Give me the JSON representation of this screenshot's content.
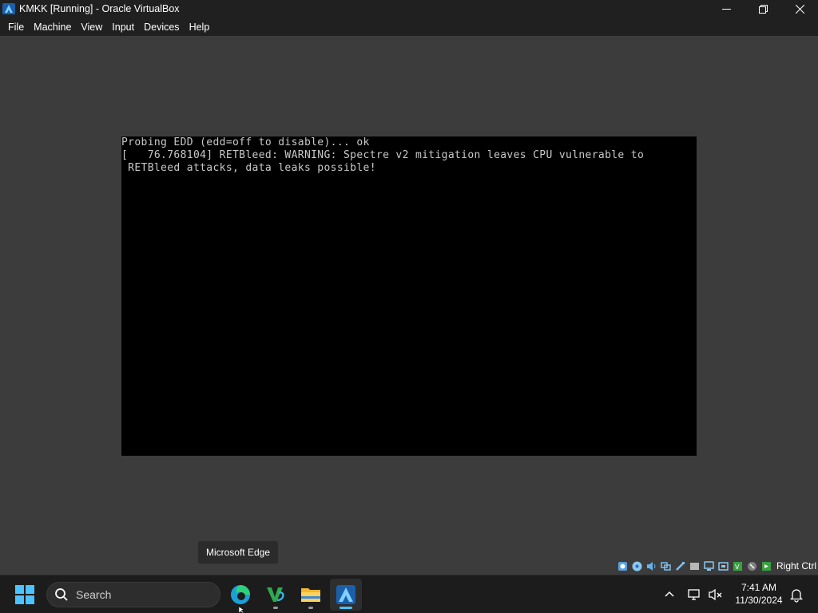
{
  "window": {
    "title": "KMKK [Running] - Oracle VirtualBox",
    "app_icon": "virtualbox-icon",
    "controls": [
      "minimize-icon",
      "restore-icon",
      "close-icon"
    ]
  },
  "menubar": {
    "items": [
      "File",
      "Machine",
      "View",
      "Input",
      "Devices",
      "Help"
    ]
  },
  "console": {
    "lines": [
      "Probing EDD (edd=off to disable)... ok",
      "[   76.768104] RETBleed: WARNING: Spectre v2 mitigation leaves CPU vulnerable to",
      " RETBleed attacks, data leaks possible!"
    ]
  },
  "tooltip": {
    "text": "Microsoft Edge"
  },
  "vm_status": {
    "icons": [
      "hard-disk-icon",
      "optical-drive-icon",
      "audio-icon",
      "network-icon",
      "usb-icon",
      "shared-folders-icon",
      "display-icon",
      "video-capture-icon",
      "cpu-icon",
      "mouse-integration-icon",
      "keyboard-icon"
    ],
    "host_key": "Right Ctrl"
  },
  "taskbar": {
    "search_label": "Search",
    "apps": [
      {
        "name": "Microsoft Edge",
        "icon": "edge-icon",
        "active": false
      },
      {
        "name": "Visual Studio",
        "icon": "visual-studio-icon",
        "active": false
      },
      {
        "name": "File Explorer",
        "icon": "file-explorer-icon",
        "active": false
      },
      {
        "name": "Oracle VirtualBox",
        "icon": "virtualbox-icon",
        "active": true
      }
    ],
    "time": "7:41 AM",
    "date": "11/30/2024"
  },
  "colors": {
    "accent": "#4cc2ff",
    "vm_background": "#3c3c3c",
    "titlebar": "#202020",
    "taskbar": "#1c1c1c"
  }
}
